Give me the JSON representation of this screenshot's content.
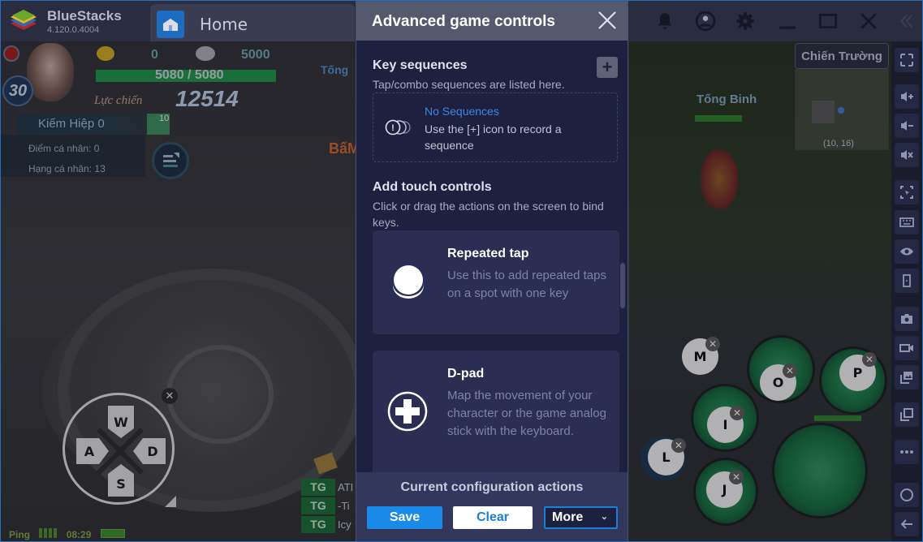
{
  "app": {
    "name": "BlueStacks",
    "version": "4.120.0.4004"
  },
  "tabs": [
    {
      "label": "Home",
      "icon": "home-icon"
    }
  ],
  "titlebar_icons": [
    "bell-icon",
    "account-icon",
    "gear-icon",
    "minimize-icon",
    "maximize-icon",
    "close-icon",
    "collapse-sidebar-icon"
  ],
  "game": {
    "hud": {
      "level": "30",
      "gold": "0",
      "silver": "5000",
      "hp": "5080 / 5080",
      "hp_fraction": 1.0,
      "power_label": "Lực chiến",
      "power_value": "12514",
      "name": "Kiếm Hiệp 0",
      "item_count": "10",
      "personal_points": "Điểm cá nhân: 0",
      "personal_rank": "Hạng cá nhân: 13",
      "top_label": "Tống",
      "bam_label": "BấM"
    },
    "battlefield": {
      "label": "Chiến Trường",
      "coords": "(10, 16)"
    },
    "enemy": {
      "name": "Tống Binh"
    },
    "status": {
      "ping": "Ping",
      "time": "08:29"
    },
    "chat": [
      {
        "badge": "TG",
        "text": "ATI"
      },
      {
        "badge": "TG",
        "text": "-Ti"
      },
      {
        "badge": "TG",
        "text": "Icy"
      }
    ],
    "dpad_keys": {
      "up": "W",
      "left": "A",
      "right": "D",
      "down": "S"
    },
    "skill_keys": [
      "M",
      "O",
      "P",
      "I",
      "L",
      "J"
    ]
  },
  "sidebar": [
    {
      "name": "fullscreen",
      "icon": "fullscreen-icon"
    },
    {
      "name": "volume-up",
      "icon": "volume-up-icon"
    },
    {
      "name": "volume-down",
      "icon": "volume-down-icon"
    },
    {
      "name": "mute",
      "icon": "mute-icon"
    },
    {
      "name": "screen-region",
      "icon": "screen-region-icon"
    },
    {
      "name": "keyboard",
      "icon": "keyboard-icon"
    },
    {
      "name": "eye",
      "icon": "eye-icon"
    },
    {
      "name": "rotate",
      "icon": "phone-icon"
    },
    {
      "name": "screenshot",
      "icon": "camera-icon"
    },
    {
      "name": "record",
      "icon": "video-icon"
    },
    {
      "name": "media",
      "icon": "media-folder-icon"
    },
    {
      "name": "multi-instance",
      "icon": "multi-instance-icon"
    },
    {
      "name": "more",
      "icon": "more-icon"
    },
    {
      "name": "home",
      "icon": "circle-home-icon"
    },
    {
      "name": "back",
      "icon": "back-arrow-icon"
    }
  ],
  "panel": {
    "title": "Advanced game controls",
    "key_sequences": {
      "title": "Key sequences",
      "subtitle": "Tap/combo sequences are listed here.",
      "empty_title": "No Sequences",
      "empty_desc": "Use the [+] icon to record a sequence"
    },
    "touch_controls": {
      "title": "Add touch controls",
      "subtitle": "Click or drag the actions on the screen to bind keys.",
      "cards": [
        {
          "title": "Repeated tap",
          "desc": "Use this to add repeated taps on a spot with one key",
          "icon": "repeated-tap-icon"
        },
        {
          "title": "D-pad",
          "desc": "Map the movement of your character or the game analog stick with the keyboard.",
          "icon": "dpad-icon"
        }
      ]
    },
    "footer": {
      "title": "Current configuration actions",
      "save": "Save",
      "clear": "Clear",
      "more": "More"
    },
    "colors": {
      "accent": "#1a8ae8",
      "link": "#3f86df",
      "bg": "#1e2040"
    }
  }
}
